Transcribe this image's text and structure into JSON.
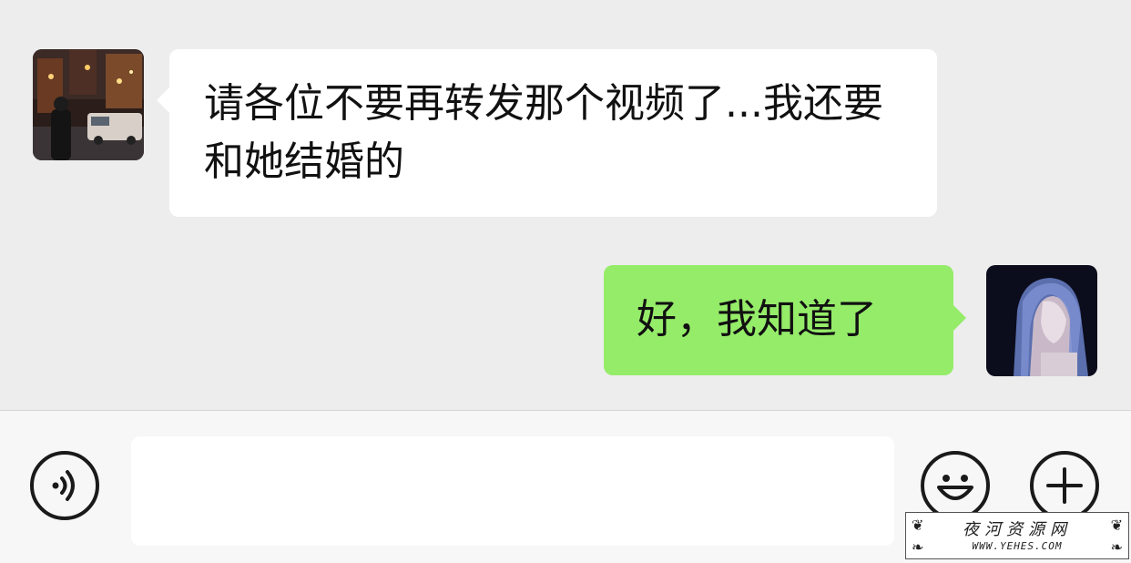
{
  "messages": [
    {
      "direction": "incoming",
      "avatar": "night-street-photo",
      "text": "请各位不要再转发那个视频了...我还要和她结婚的"
    },
    {
      "direction": "outgoing",
      "avatar": "girl-portrait-photo",
      "text": "好，我知道了"
    }
  ],
  "input_bar": {
    "voice_icon": "voice-icon",
    "text_value": "",
    "emoji_icon": "smiley-icon",
    "more_icon": "plus-icon"
  },
  "watermark": {
    "title": "夜河资源网",
    "url": "WWW.YEHES.COM"
  },
  "colors": {
    "background": "#ededed",
    "incoming_bubble": "#ffffff",
    "outgoing_bubble": "#95ec69",
    "input_bar": "#f7f7f7"
  }
}
